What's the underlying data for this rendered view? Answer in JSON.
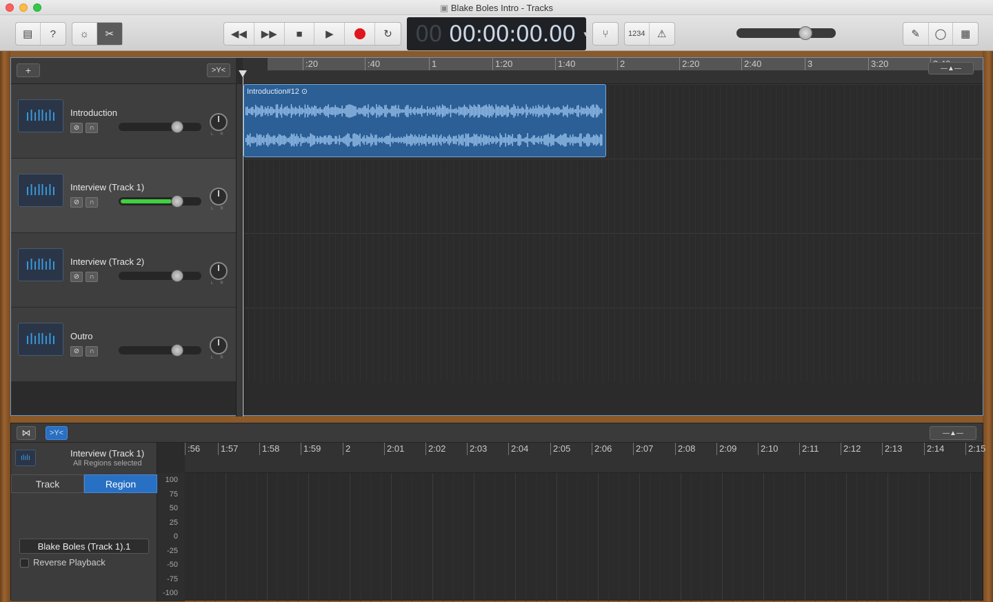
{
  "window": {
    "title": "Blake Boles Intro - Tracks"
  },
  "lcd": {
    "prefix": "00",
    "time": "00:00:00.00"
  },
  "toolbar": {
    "count_in": "1234"
  },
  "ruler": {
    "labels": [
      ":20",
      ":40",
      "1",
      "1:20",
      "1:40",
      "2",
      "2:20",
      "2:40",
      "3",
      "3:20",
      "3:40"
    ]
  },
  "tracks": [
    {
      "name": "Introduction",
      "selected": false,
      "level": 0
    },
    {
      "name": "Interview (Track 1)",
      "selected": true,
      "level": 0.62
    },
    {
      "name": "Interview (Track 2)",
      "selected": false,
      "level": 0
    },
    {
      "name": "Outro",
      "selected": false,
      "level": 0
    }
  ],
  "region": {
    "name": "Introduction#12"
  },
  "editor": {
    "track_name": "Interview (Track 1)",
    "subtitle": "All Regions selected",
    "tabs": [
      "Track",
      "Region"
    ],
    "active_tab": "Region",
    "region_name": "Blake Boles (Track 1).1",
    "reverse_label": "Reverse Playback",
    "ruler": [
      ":56",
      "1:57",
      "1:58",
      "1:59",
      "2",
      "2:01",
      "2:02",
      "2:03",
      "2:04",
      "2:05",
      "2:06",
      "2:07",
      "2:08",
      "2:09",
      "2:10",
      "2:11",
      "2:12",
      "2:13",
      "2:14",
      "2:15"
    ],
    "y_labels": [
      "100",
      "75",
      "50",
      "25",
      "0",
      "-25",
      "-50",
      "-75",
      "-100"
    ]
  },
  "colors": {
    "accent": "#2870c4",
    "region": "#2b5f95",
    "record": "#e0161b"
  }
}
